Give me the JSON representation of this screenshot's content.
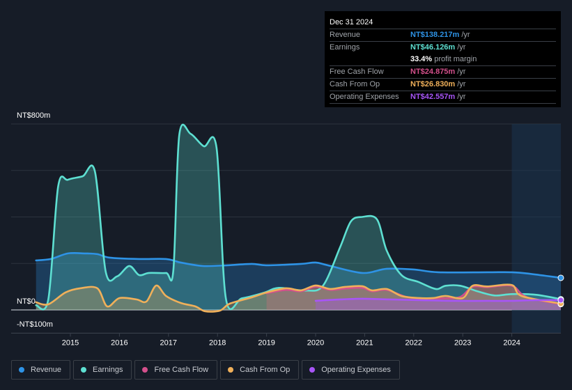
{
  "tooltip": {
    "date": "Dec 31 2024",
    "rows": [
      {
        "label": "Revenue",
        "value": "NT$138.217m",
        "unit": "/yr",
        "color": "#2e93e6"
      },
      {
        "label": "Earnings",
        "value": "NT$46.126m",
        "unit": "/yr",
        "color": "#5ee0d2"
      },
      {
        "label": "",
        "value": "33.4%",
        "unit": "profit margin",
        "color": "#ffffff"
      },
      {
        "label": "Free Cash Flow",
        "value": "NT$24.875m",
        "unit": "/yr",
        "color": "#d4508c"
      },
      {
        "label": "Cash From Op",
        "value": "NT$26.830m",
        "unit": "/yr",
        "color": "#f0b05a"
      },
      {
        "label": "Operating Expenses",
        "value": "NT$42.557m",
        "unit": "/yr",
        "color": "#a855f7"
      }
    ]
  },
  "chart_data": {
    "type": "area",
    "title": "",
    "xlabel": "",
    "ylabel": "",
    "y_tick_labels": [
      "NT$800m",
      "NT$0",
      "-NT$100m"
    ],
    "ylim": [
      -100,
      800
    ],
    "y_gridlines": [
      800,
      600,
      400,
      200,
      0,
      -100
    ],
    "x_tick_labels": [
      "2015",
      "2016",
      "2017",
      "2018",
      "2019",
      "2020",
      "2021",
      "2022",
      "2023",
      "2024"
    ],
    "xlim": [
      2014.3,
      2025.0
    ],
    "highlight_from": 2024.0,
    "grid": true,
    "legend_position": "bottom-left",
    "series": [
      {
        "name": "Revenue",
        "color": "#2e93e6",
        "x": [
          2014.3,
          2014.6,
          2014.95,
          2015.3,
          2015.55,
          2015.8,
          2016.4,
          2016.95,
          2017.25,
          2017.7,
          2018.2,
          2018.7,
          2019.0,
          2019.7,
          2020.0,
          2020.25,
          2020.95,
          2021.45,
          2022.0,
          2022.5,
          2023.5,
          2024.0,
          2024.35,
          2025.0
        ],
        "values": [
          213,
          219,
          243,
          243,
          240,
          225,
          219,
          219,
          204,
          189,
          192,
          198,
          192,
          198,
          204,
          192,
          159,
          177,
          174,
          162,
          162,
          162,
          156,
          138
        ]
      },
      {
        "name": "Earnings",
        "color": "#5ee0d2",
        "x": [
          2014.3,
          2014.55,
          2014.75,
          2014.95,
          2015.25,
          2015.5,
          2015.72,
          2015.95,
          2016.2,
          2016.4,
          2016.6,
          2016.95,
          2017.1,
          2017.22,
          2017.45,
          2017.72,
          2017.98,
          2018.17,
          2018.5,
          2018.95,
          2019.25,
          2019.8,
          2020.15,
          2020.5,
          2020.72,
          2020.95,
          2021.25,
          2021.45,
          2021.75,
          2022.1,
          2022.45,
          2022.65,
          2022.95,
          2023.3,
          2023.65,
          2024.0,
          2024.5,
          2025.0
        ],
        "values": [
          20,
          45,
          530,
          560,
          575,
          596,
          165,
          144,
          189,
          150,
          159,
          159,
          171,
          752,
          758,
          704,
          698,
          50,
          50,
          74,
          95,
          83,
          104,
          270,
          381,
          400,
          390,
          255,
          150,
          120,
          90,
          104,
          104,
          80,
          62,
          68,
          65,
          46
        ]
      },
      {
        "name": "Free Cash Flow",
        "color": "#d4508c",
        "x": [
          2019.0,
          2019.4,
          2019.7,
          2020.0,
          2020.3,
          2020.6,
          2020.95,
          2021.15,
          2021.45,
          2021.85,
          2022.2,
          2022.6,
          2022.95,
          2023.2,
          2023.5,
          2024.0,
          2024.3,
          2025.0
        ],
        "values": [
          72,
          86,
          80,
          100,
          86,
          92,
          95,
          80,
          86,
          56,
          50,
          50,
          56,
          100,
          98,
          104,
          55,
          25
        ]
      },
      {
        "name": "Cash From Op",
        "color": "#f0b05a",
        "x": [
          2014.3,
          2014.55,
          2014.9,
          2015.2,
          2015.55,
          2015.75,
          2016.0,
          2016.35,
          2016.55,
          2016.75,
          2016.95,
          2017.25,
          2017.55,
          2017.75,
          2018.05,
          2018.25,
          2018.7,
          2019.0,
          2019.4,
          2019.7,
          2020.0,
          2020.3,
          2020.6,
          2020.95,
          2021.15,
          2021.45,
          2021.75,
          2022.1,
          2022.4,
          2022.65,
          2023.0,
          2023.2,
          2023.5,
          2024.0,
          2024.2,
          2025.0
        ],
        "values": [
          33,
          24,
          75,
          93,
          93,
          15,
          51,
          45,
          36,
          105,
          60,
          30,
          15,
          -6,
          -3,
          27,
          54,
          75,
          93,
          84,
          105,
          90,
          99,
          102,
          84,
          90,
          60,
          51,
          51,
          60,
          51,
          104,
          101,
          107,
          60,
          27
        ]
      },
      {
        "name": "Operating Expenses",
        "color": "#a855f7",
        "x": [
          2020.0,
          2020.5,
          2020.95,
          2021.5,
          2022.1,
          2022.8,
          2023.5,
          2024.0,
          2024.5,
          2025.0
        ],
        "values": [
          39,
          45,
          48,
          45,
          42,
          39,
          39,
          39,
          42,
          42
        ]
      }
    ]
  },
  "legend": [
    {
      "label": "Revenue",
      "color": "#2e93e6"
    },
    {
      "label": "Earnings",
      "color": "#5ee0d2"
    },
    {
      "label": "Free Cash Flow",
      "color": "#d4508c"
    },
    {
      "label": "Cash From Op",
      "color": "#f0b05a"
    },
    {
      "label": "Operating Expenses",
      "color": "#a855f7"
    }
  ]
}
